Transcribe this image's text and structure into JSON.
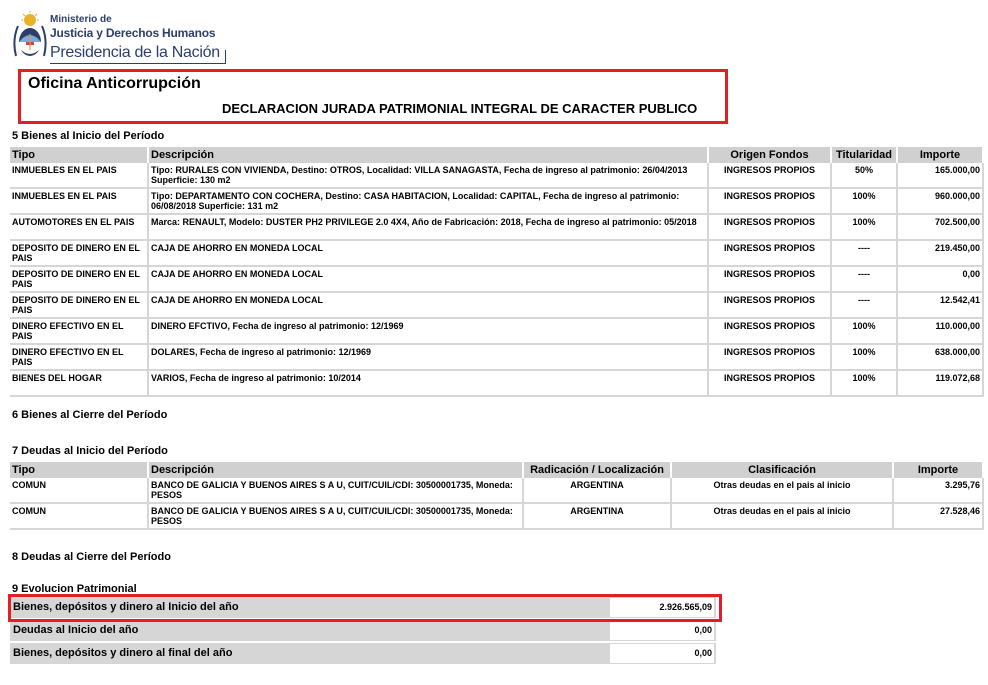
{
  "header": {
    "ministerio_line1": "Ministerio de",
    "ministerio_line2": "Justicia y Derechos Humanos",
    "presidencia": "Presidencia de la Nación",
    "office_title": "Oficina Anticorrupción",
    "declaration_title": "DECLARACION JURADA PATRIMONIAL INTEGRAL DE CARACTER PUBLICO",
    "highlight_color": "#e31e24"
  },
  "section5": {
    "title": "5 Bienes al Inicio del Período",
    "columns": [
      "Tipo",
      "Descripción",
      "Origen Fondos",
      "Titularidad",
      "Importe"
    ],
    "rows": [
      {
        "tipo": "INMUEBLES EN EL PAIS",
        "descripcion": "Tipo: RURALES CON VIVIENDA, Destino: OTROS, Localidad: VILLA SANAGASTA, Fecha de ingreso al patrimonio: 26/04/2013 Superficie: 130 m2",
        "origen": "INGRESOS PROPIOS",
        "titularidad": "50%",
        "importe": "165.000,00"
      },
      {
        "tipo": "INMUEBLES EN EL PAIS",
        "descripcion": "Tipo: DEPARTAMENTO CON COCHERA, Destino: CASA HABITACION, Localidad: CAPITAL, Fecha de ingreso al patrimonio: 06/08/2018 Superficie: 131 m2",
        "origen": "INGRESOS PROPIOS",
        "titularidad": "100%",
        "importe": "960.000,00"
      },
      {
        "tipo": "AUTOMOTORES EN EL PAIS",
        "descripcion": "Marca: RENAULT, Modelo: DUSTER PH2 PRIVILEGE 2.0 4X4, Año de Fabricación: 2018, Fecha de ingreso al patrimonio: 05/2018",
        "origen": "INGRESOS PROPIOS",
        "titularidad": "100%",
        "importe": "702.500,00"
      },
      {
        "tipo": "DEPOSITO DE DINERO EN EL PAIS",
        "descripcion": "CAJA DE AHORRO EN MONEDA LOCAL",
        "origen": "INGRESOS PROPIOS",
        "titularidad": "----",
        "importe": "219.450,00"
      },
      {
        "tipo": "DEPOSITO DE DINERO EN EL PAIS",
        "descripcion": "CAJA DE AHORRO EN MONEDA LOCAL",
        "origen": "INGRESOS PROPIOS",
        "titularidad": "----",
        "importe": "0,00"
      },
      {
        "tipo": "DEPOSITO DE DINERO EN EL PAIS",
        "descripcion": "CAJA DE AHORRO EN MONEDA LOCAL",
        "origen": "INGRESOS PROPIOS",
        "titularidad": "----",
        "importe": "12.542,41"
      },
      {
        "tipo": "DINERO EFECTIVO EN EL PAIS",
        "descripcion": "DINERO EFCTIVO, Fecha de ingreso al patrimonio: 12/1969",
        "origen": "INGRESOS PROPIOS",
        "titularidad": "100%",
        "importe": "110.000,00"
      },
      {
        "tipo": "DINERO EFECTIVO EN EL PAIS",
        "descripcion": "DOLARES, Fecha de ingreso al patrimonio: 12/1969",
        "origen": "INGRESOS PROPIOS",
        "titularidad": "100%",
        "importe": "638.000,00"
      },
      {
        "tipo": "BIENES DEL HOGAR",
        "descripcion": "VARIOS, Fecha de ingreso al patrimonio: 10/2014",
        "origen": "INGRESOS PROPIOS",
        "titularidad": "100%",
        "importe": "119.072,68"
      }
    ]
  },
  "section6": {
    "title": "6 Bienes al Cierre del Período"
  },
  "section7": {
    "title": "7 Deudas al Inicio del Período",
    "columns": [
      "Tipo",
      "Descripción",
      "Radicación / Localización",
      "Clasificación",
      "Importe"
    ],
    "rows": [
      {
        "tipo": "COMUN",
        "descripcion": "BANCO DE GALICIA Y BUENOS AIRES S A U, CUIT/CUIL/CDI: 30500001735, Moneda: PESOS",
        "radicacion": "ARGENTINA",
        "clasificacion": "Otras deudas en el pais al inicio",
        "importe": "3.295,76"
      },
      {
        "tipo": "COMUN",
        "descripcion": "BANCO DE GALICIA Y BUENOS AIRES S A U, CUIT/CUIL/CDI: 30500001735, Moneda: PESOS",
        "radicacion": "ARGENTINA",
        "clasificacion": "Otras deudas en el pais al inicio",
        "importe": "27.528,46"
      }
    ]
  },
  "section8": {
    "title": "8 Deudas al Cierre del Período"
  },
  "section9": {
    "title": "9 Evolucion Patrimonial",
    "rows": [
      {
        "label": "Bienes, depósitos y dinero al Inicio del año",
        "value": "2.926.565,09"
      },
      {
        "label": "Deudas al Inicio del año",
        "value": "0,00"
      },
      {
        "label": "Bienes, depósitos y dinero al final del año",
        "value": "0,00"
      }
    ]
  }
}
